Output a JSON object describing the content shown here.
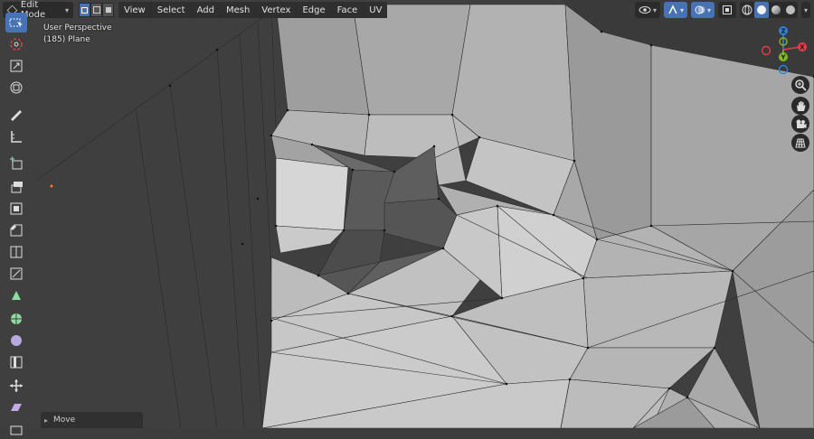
{
  "header": {
    "mode": "Edit Mode",
    "menus": [
      "View",
      "Select",
      "Add",
      "Mesh",
      "Vertex",
      "Edge",
      "Face",
      "UV"
    ]
  },
  "overlay": {
    "perspective": "User Perspective",
    "object": "(185) Plane"
  },
  "last_operator": {
    "label": "Move"
  },
  "gizmo": {
    "x_label": "X",
    "y_label": "Y",
    "z_label": "Z",
    "colors": {
      "x": "#e83a4a",
      "y": "#7dbb1e",
      "z": "#2f83d9"
    }
  },
  "icons": {
    "toolbar": [
      "select-box-icon",
      "cursor-icon",
      "move-icon",
      "rotate-icon",
      "scale-icon",
      "transform-icon",
      "annotate-icon",
      "measure-icon",
      "add-cube-icon",
      "extrude-region-icon",
      "inset-faces-icon",
      "bevel-icon",
      "loop-cut-icon",
      "knife-icon",
      "poly-build-icon",
      "spin-icon",
      "smooth-icon",
      "edge-slide-icon",
      "shrink-fatten-icon",
      "shear-icon",
      "rip-region-icon"
    ],
    "nav": [
      "zoom-icon",
      "hand-pan-icon",
      "camera-icon",
      "grid-icon"
    ]
  },
  "accent_color": "#4772b3"
}
